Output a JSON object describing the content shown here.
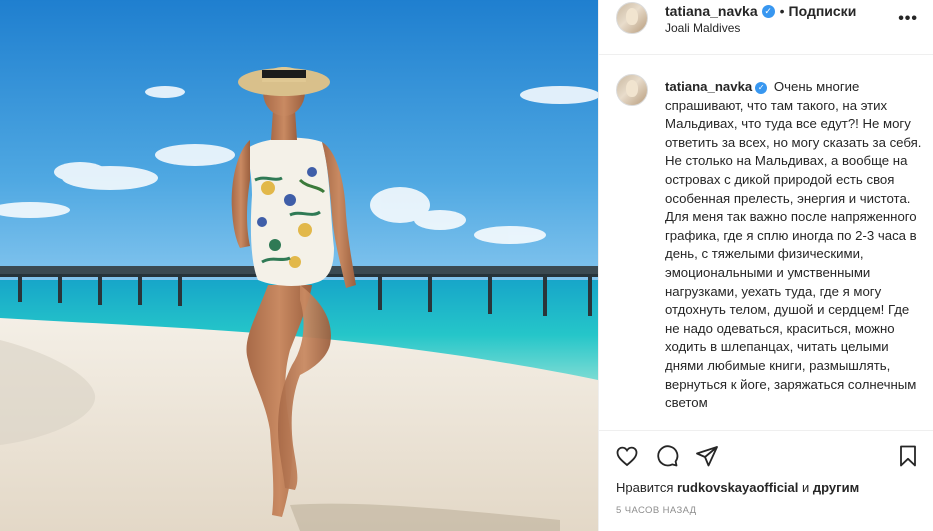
{
  "header": {
    "username": "tatiana_navka",
    "follow_separator": "•",
    "follow_label": "Подписки",
    "location": "Joali Maldives",
    "more_icon": "more-icon"
  },
  "caption": {
    "username": "tatiana_navka",
    "text": "Очень многие спрашивают, что там такого, на этих Мальдивах, что туда все едут?! Не могу ответить за всех, но могу сказать за себя. Не столько на Мальдивах, а вообще на островах с дикой природой есть своя особенная прелесть, энергия и чистота. Для меня так важно после напряженного графика, где я сплю иногда по 2-3 часа в день, с тяжелыми физическими, эмоциональными и умственными нагрузками, уехать туда, где я могу отдохнуть телом, душой и сердцем! Где не надо одеваться, краситься, можно ходить в шлепанцах, читать целыми днями любимые книги, размышлять, вернуться к йоге, заряжаться солнечным светом"
  },
  "actions": {
    "icons": [
      "heart-icon",
      "comment-icon",
      "share-icon",
      "bookmark-icon"
    ],
    "likes_prefix": "Нравится",
    "likes_user": "rudkovskayaofficial",
    "likes_and": "и",
    "likes_others": "другим",
    "time": "5 ЧАСОВ НАЗАД"
  },
  "colors": {
    "verified": "#3897f0",
    "sky": "#2f93d6",
    "sea": "#1ec3c8",
    "sand": "#efe8dc"
  }
}
